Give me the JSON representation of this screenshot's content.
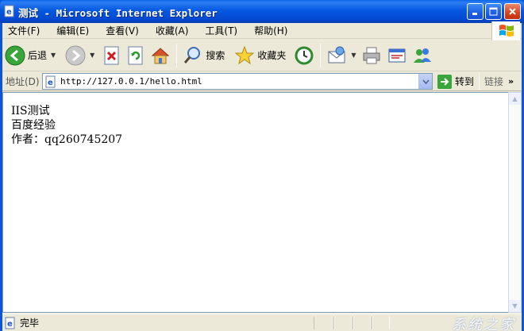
{
  "window": {
    "title": "测试 - Microsoft Internet Explorer"
  },
  "menu": {
    "items": [
      "文件(F)",
      "编辑(E)",
      "查看(V)",
      "收藏(A)",
      "工具(T)",
      "帮助(H)"
    ]
  },
  "toolbar": {
    "back_label": "后退",
    "search_label": "搜索",
    "favorites_label": "收藏夹",
    "icons": [
      "back-icon",
      "forward-icon",
      "stop-icon",
      "refresh-icon",
      "home-icon",
      "search-icon",
      "favorites-icon",
      "history-icon",
      "mail-icon",
      "print-icon",
      "edit-icon",
      "messenger-icon"
    ]
  },
  "address": {
    "label": "地址(D)",
    "url": "http://127.0.0.1/hello.html",
    "go_label": "转到",
    "links_label": "链接"
  },
  "page": {
    "lines": [
      "IIS测试",
      "百度经验",
      "作者：qq260745207"
    ]
  },
  "status": {
    "text": "完毕"
  },
  "watermark": {
    "text": "系统之家"
  },
  "colors": {
    "titlebar": "#0558e1",
    "chrome": "#ece9d8",
    "content_bg": "#ffffff"
  }
}
